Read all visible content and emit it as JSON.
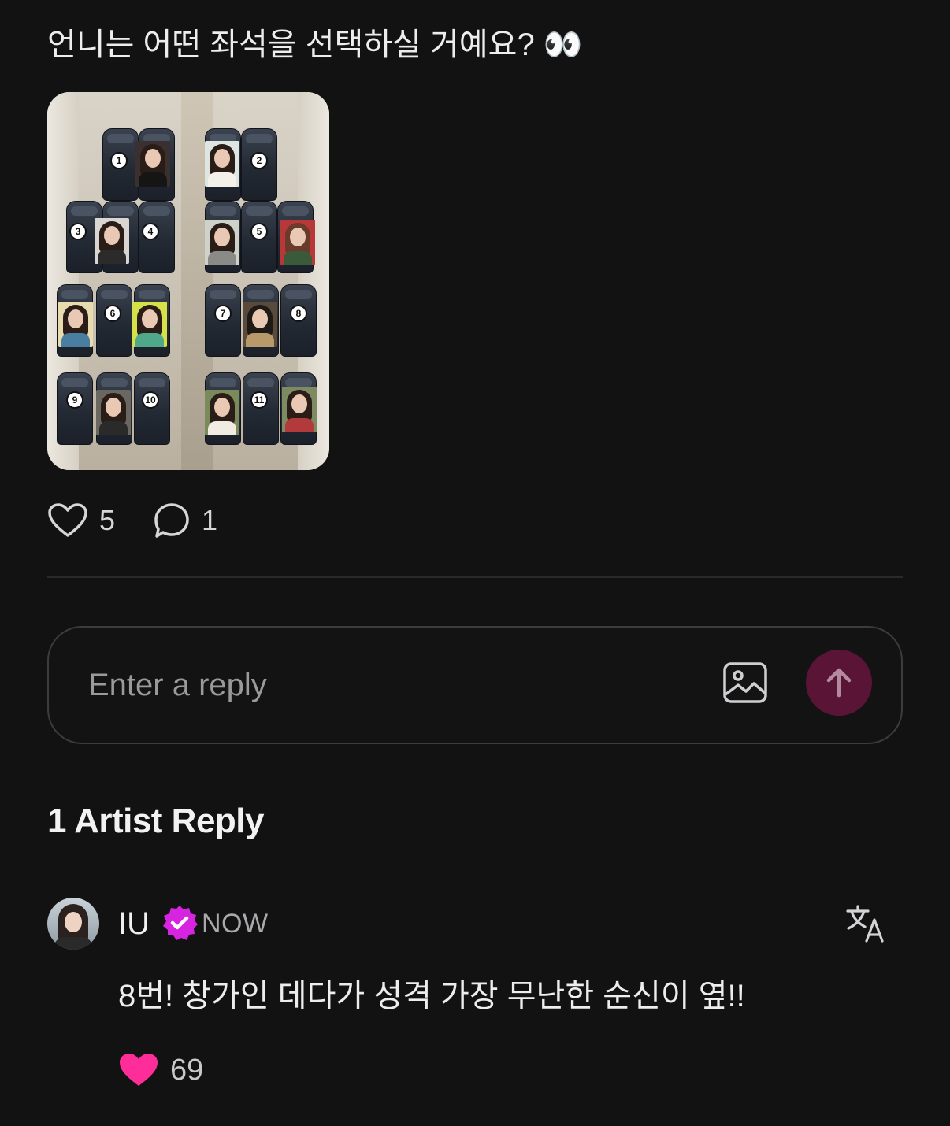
{
  "post": {
    "text": "언니는 어떤 좌석을 선택하실 거예요? 👀",
    "image_seat_numbers": [
      "1",
      "2",
      "3",
      "4",
      "5",
      "6",
      "7",
      "8",
      "9",
      "10",
      "11"
    ],
    "likes": "5",
    "comments": "1"
  },
  "reply_box": {
    "placeholder": "Enter a reply"
  },
  "artist_replies": {
    "title": "1 Artist Reply",
    "items": [
      {
        "author": "IU",
        "time": "NOW",
        "text": "8번! 창가인 데다가 성격 가장 무난한 순신이 옆!!",
        "likes": "69"
      }
    ]
  },
  "colors": {
    "background": "#121213",
    "send_button": "#5A1436",
    "verified": "#D624E0",
    "like_filled": "#FF2D9A"
  }
}
